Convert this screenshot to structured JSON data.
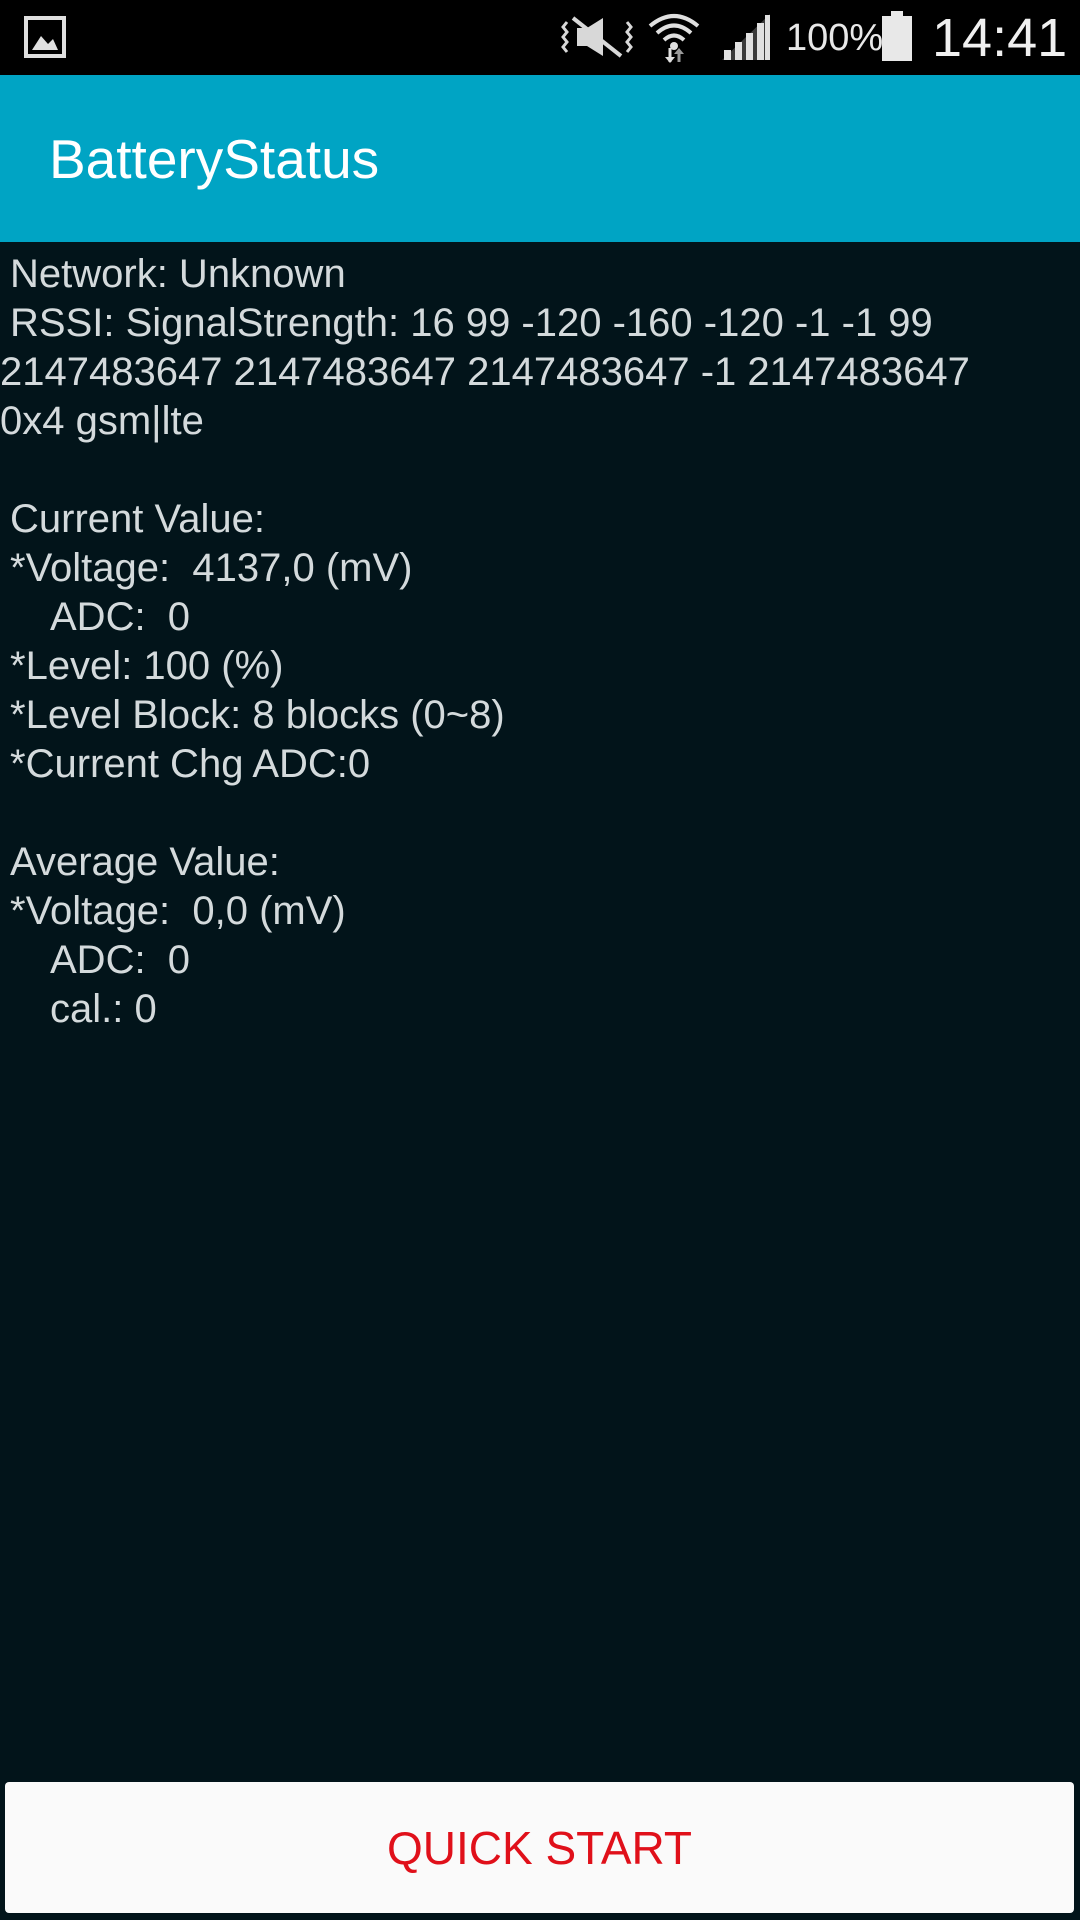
{
  "status_bar": {
    "icons": [
      "gallery-icon",
      "mute-vibrate-icon",
      "wifi-icon",
      "signal-icon",
      "battery-icon"
    ],
    "battery_percent": "100%",
    "time": "14:41"
  },
  "app_bar": {
    "title": "BatteryStatus",
    "color": "#00a4c4"
  },
  "content": {
    "network": "Network: Unknown",
    "rssi_line1": "RSSI: SignalStrength: 16 99 -120 -160 -120 -1 -1 99",
    "rssi_line2": "2147483647 2147483647 2147483647 -1 2147483647",
    "rssi_line3": "0x4 gsm|lte",
    "current": {
      "header": "Current Value:",
      "voltage": "*Voltage:  4137,0 (mV)",
      "adc": "ADC:  0",
      "level": "*Level: 100 (%)",
      "level_block": "*Level Block: 8 blocks (0~8)",
      "current_chg_adc": "*Current Chg ADC:0"
    },
    "average": {
      "header": "Average Value:",
      "voltage": "*Voltage:  0,0 (mV)",
      "adc": "ADC:  0",
      "cal": "cal.: 0"
    }
  },
  "quick_start_button": {
    "label": "QUICK START",
    "text_color": "#e0101a"
  }
}
